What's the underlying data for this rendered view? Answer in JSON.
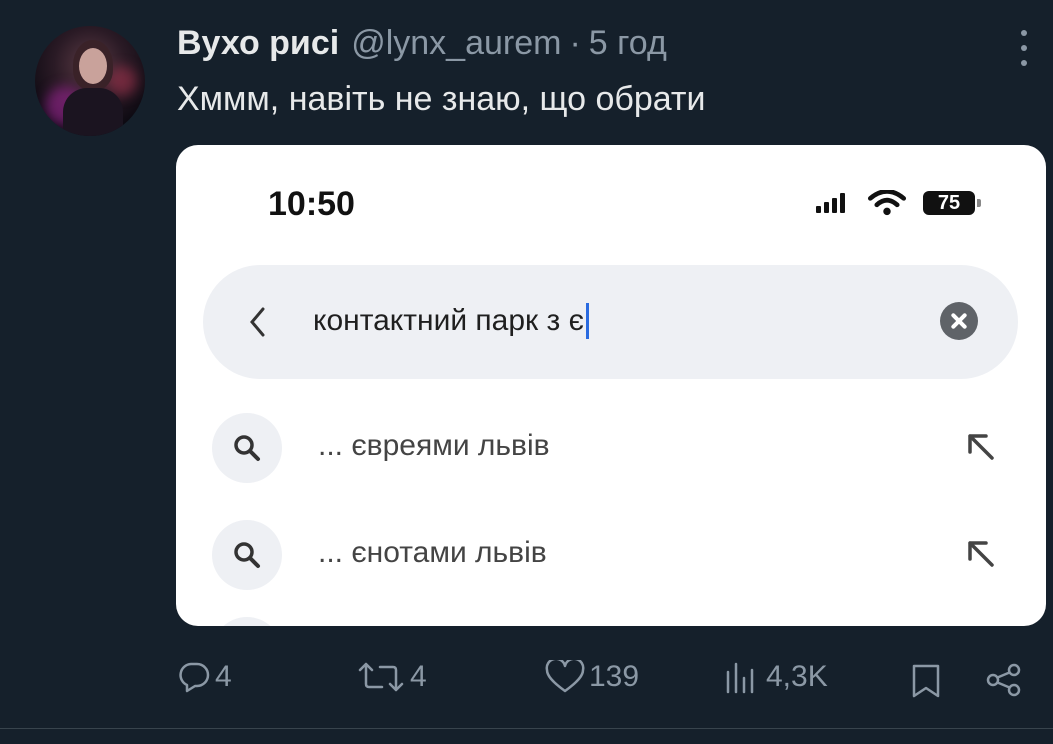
{
  "tweet": {
    "display_name": "Вухо рисі",
    "handle": "@lynx_aurem",
    "separator": "·",
    "time": "5 год",
    "text": "Хммм, навіть не знаю, що обрати"
  },
  "screenshot": {
    "clock": "10:50",
    "battery": "75",
    "search_value": "контактний парк з є",
    "suggestions": [
      {
        "label": "... євреями львів"
      },
      {
        "label": "... єнотами львів"
      }
    ]
  },
  "actions": {
    "replies": "4",
    "retweets": "4",
    "likes": "139",
    "views": "4,3K"
  },
  "colors": {
    "background": "#15202b",
    "primary_text": "#e7e9ea",
    "secondary_text": "#8b98a5",
    "caret": "#2a6be0"
  }
}
